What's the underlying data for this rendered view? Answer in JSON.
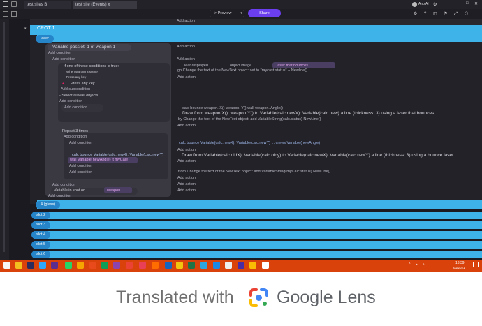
{
  "tabs": [
    {
      "label": "test sites B"
    },
    {
      "label": "test site (Events) x"
    }
  ],
  "toolbar": {
    "preview": "> Preview",
    "share": "Share",
    "user": "Anb Al"
  },
  "events": {
    "add_action": "Add action",
    "add_condition": "Add condition",
    "group_crot": "CROT 1",
    "group_laser": "laser",
    "variable_passlot": "Variable passlot. 1 of weapon 1",
    "if_one": "If one of these conditions is true:",
    "when_starting": "When starting a scene",
    "press_any_key_small": "Press any key",
    "clear_displayed": "Clear displayed",
    "object_image": "object image",
    "laser_bounces": "laser that bounces",
    "go_change": "go Change the text of the NewText object: set to \"raycast status\" + Newline()",
    "press_any_key": "Press any key",
    "add_subcondition": "Add subcondition",
    "select_all_walls": "- Select all wall objects",
    "calc_bounce": "calc bounce weapon. X() weapon. Y() wall weapon. Angle()",
    "draw_from_weapon": "Draw from weapon.X(): weapon.Y() to Variable(calc.newX): Variable(calc.new) a line (thickness: 3) using a laser that bounces",
    "by_change": "by Change the text of the NewText object: add VariableString(calc.status) NewLine()",
    "repeat": "Repeat 3 times",
    "calc_bounce2": "calc bounce Variable(calc.newX): Variable(calc.newY) ... crews Variable(newAngle)",
    "calc_bounce_inner": "calc bounce Variable(calc.newX): Variable(calc.newY)",
    "wall_variable": "wall Variable(newAngle) it myCale",
    "draw_from_old": "Draw from Variable(calc.oldX); Variable(calc.oldy) to Variable(calc.newX); Variable(calc.newY) a line (thickness: 3) using a bounce laser",
    "from_change": "from Change the text of the NewText object: add VariableString(myCalc.status) NewLine()",
    "variable_spot": "Variable in spot on",
    "weapon": "weapon",
    "glass": "4 (glass)",
    "slots": [
      "slot 2",
      "slot 3",
      "slot 4",
      "slot 5",
      "slot 6"
    ]
  },
  "taskbar": {
    "time": "13:39",
    "date": "2/1/2021"
  },
  "lens": {
    "translated": "Translated with",
    "brand": "Google Lens"
  },
  "colors": {
    "accent_blue": "#3db3ea",
    "share_purple": "#6b3ff0",
    "taskbar_orange": "#d9420b"
  }
}
